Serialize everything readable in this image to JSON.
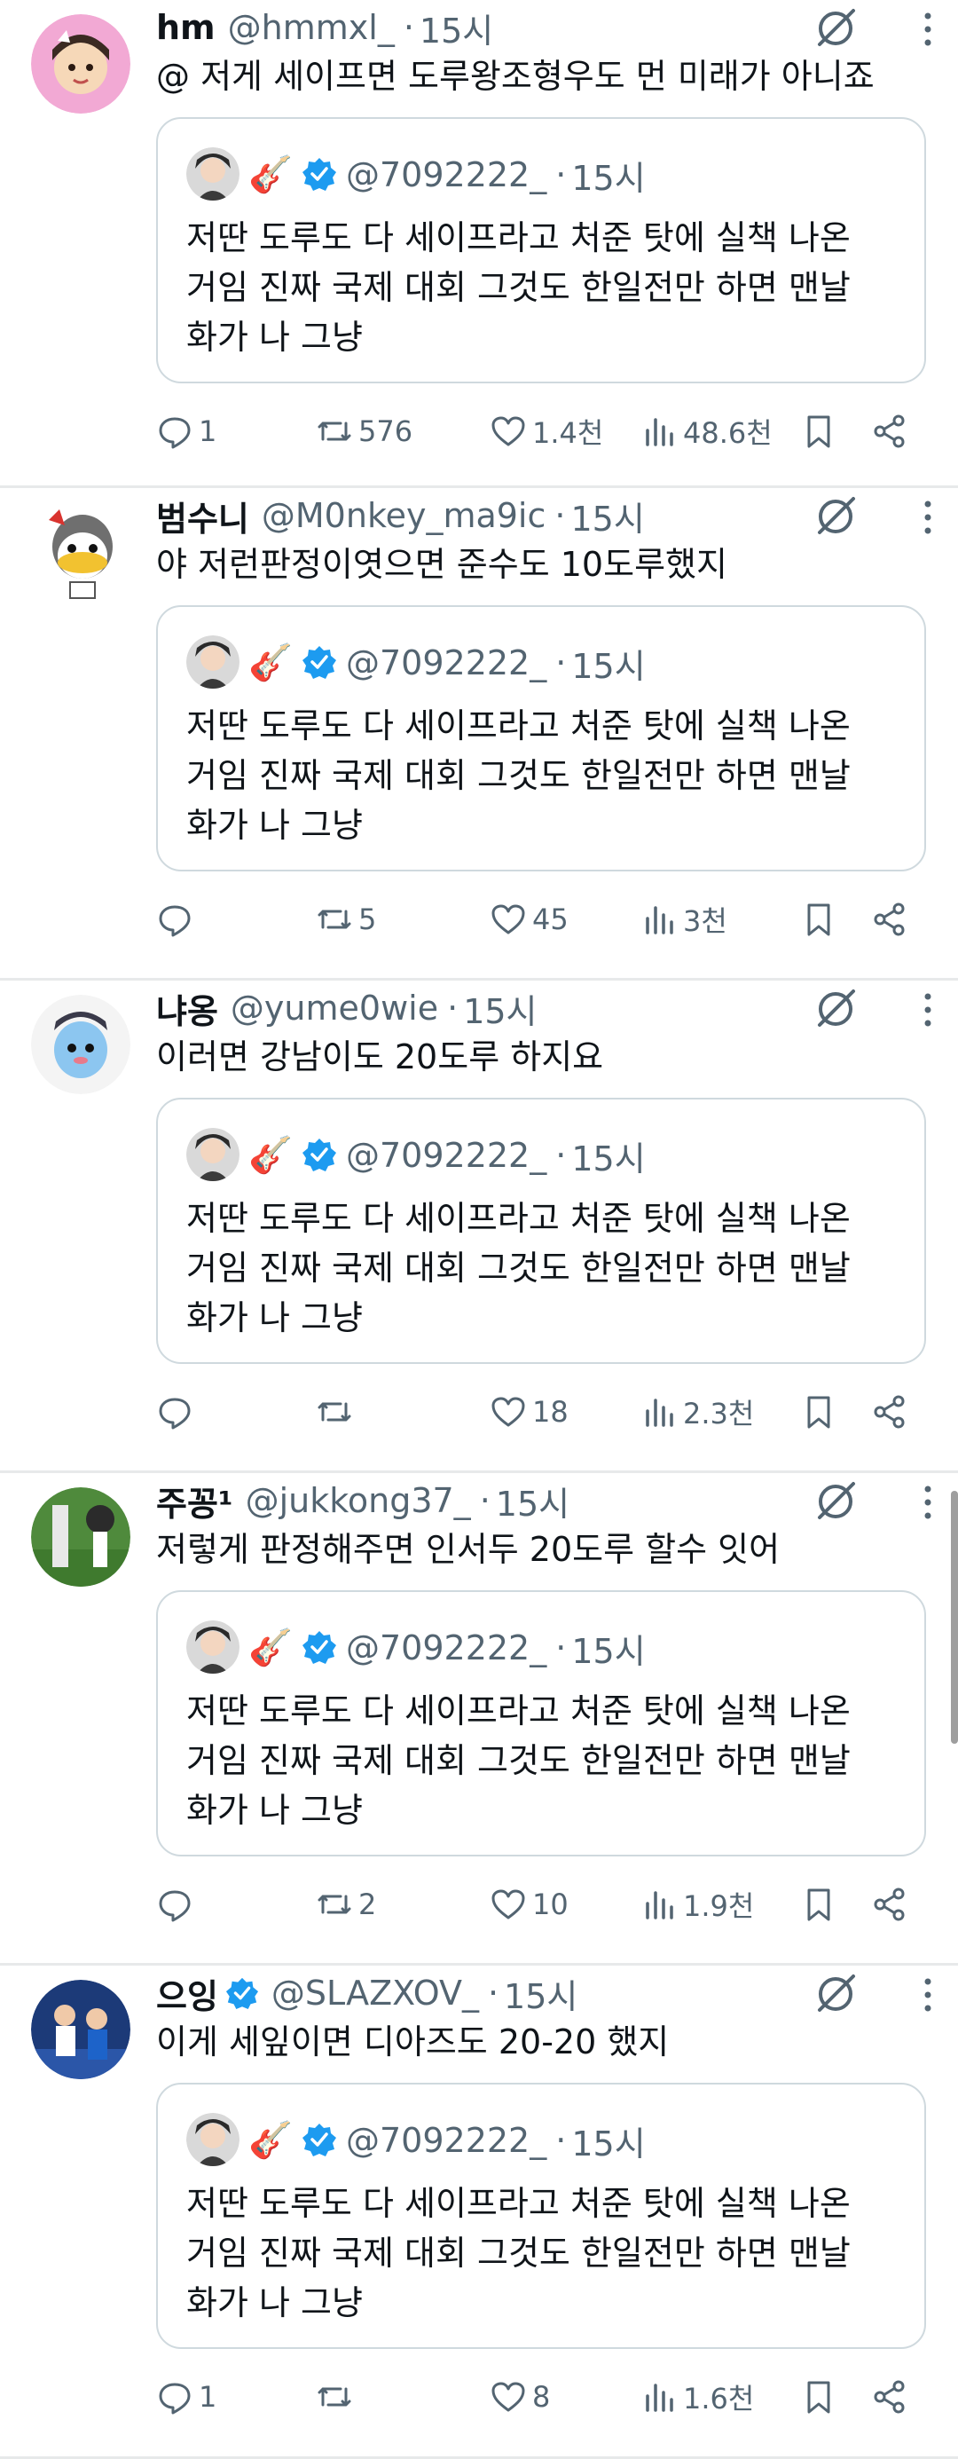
{
  "colors": {
    "text": "#0f1419",
    "secondary": "#536471",
    "border": "#cfd9de",
    "verified": "#1d9bf0",
    "divider": "#e7e9ea"
  },
  "icons": {
    "grok": "grok-icon",
    "more": "more-vertical-icon",
    "reply": "reply-icon",
    "retweet": "retweet-icon",
    "like": "like-icon",
    "views": "views-icon",
    "bookmark": "bookmark-icon",
    "share": "share-icon",
    "verified": "verified-badge-icon"
  },
  "quoted": {
    "emoji": "🎸",
    "handle": "@7092222_",
    "dot": "·",
    "time": "15시",
    "text": "저딴 도루도 다 세이프라고 처준 탓에 실책 나온\n거임 진짜 국제 대회 그것도 한일전만 하면 맨날\n화가 나 그냥"
  },
  "tweets": [
    {
      "name": "hm",
      "handle": "@hmmxl_",
      "dot": "·",
      "time": "15시",
      "verified": false,
      "text": "@ 저게 세이프면 도루왕조형우도 먼 미래가 아니죠",
      "replies": "1",
      "retweets": "576",
      "likes": "1.4천",
      "views": "48.6천"
    },
    {
      "name": "범수니",
      "handle": "@M0nkey_ma9ic",
      "dot": "·",
      "time": "15시",
      "verified": false,
      "text": "야 저런판정이엿으면 준수도 10도루했지",
      "replies": "",
      "retweets": "5",
      "likes": "45",
      "views": "3천"
    },
    {
      "name": "냐옹",
      "handle": "@yume0wie",
      "dot": "·",
      "time": "15시",
      "verified": false,
      "text": "이러면 강남이도 20도루 하지요",
      "replies": "",
      "retweets": "",
      "likes": "18",
      "views": "2.3천"
    },
    {
      "name": "주꽁¹",
      "handle": "@jukkong37_",
      "dot": "·",
      "time": "15시",
      "verified": false,
      "text": "저렇게 판정해주면 인서두 20도루 할수 잇어",
      "replies": "",
      "retweets": "2",
      "likes": "10",
      "views": "1.9천"
    },
    {
      "name": "으잉",
      "handle": "@SLAZXOV_",
      "dot": "·",
      "time": "15시",
      "verified": true,
      "text": "이게 세잎이면 디아즈도 20-20 했지",
      "replies": "1",
      "retweets": "",
      "likes": "8",
      "views": "1.6천"
    }
  ]
}
